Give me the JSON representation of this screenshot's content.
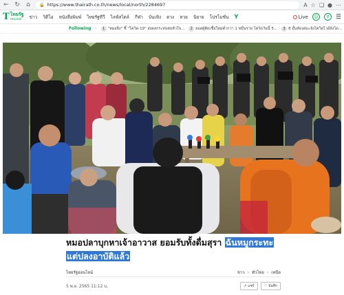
{
  "browser": {
    "url": "https://www.thairath.co.th/news/local/north/2284697",
    "back_icon": "back-arrow-icon",
    "refresh_icon": "refresh-icon",
    "home_icon": "home-icon"
  },
  "header": {
    "logo_main": "ไทยรัฐ",
    "logo_sub": "ONLINE",
    "menu": [
      "ข่าว",
      "วิดีโอ",
      "หนังสือพิมพ์",
      "ไทยรัฐทีวี",
      "ไลฟ์สไตล์",
      "กีฬา",
      "บันเทิง",
      "ดวง",
      "หวย",
      "นิยาย",
      "โปรโมชั่น"
    ],
    "live_label": "Live"
  },
  "ticker": {
    "following_label": "Following",
    "items": [
      {
        "num": "1",
        "text": "\"หมอยิ่ง\" ชี้ \"โควิด-19\" ส่งผลกระทบต่อหัวใจ..."
      },
      {
        "num": "2",
        "text": "ยอดผู้ติดเชื้อใหม่ต่ำกว่า 1 หมื่นราย โควิดวันนี้ 5..."
      },
      {
        "num": "3",
        "text": "8 อั้นห้องสมะจังโควิดไวอ์ลังโด..."
      }
    ]
  },
  "article": {
    "headline_plain": "หมอปลาบุกหาเจ้าอาวาส ยอมรับทั้งดื่มสุรา ",
    "headline_selected_1": "ฉันหมูกระทะ",
    "headline_selected_2": "แต่ปลงอาบัติแล้ว",
    "source": "ไทยรัฐออนไลน์",
    "breadcrumb": [
      "ข่าว",
      "ทั่วไทย",
      "เหนือ"
    ],
    "date": "5 พ.ย. 2565 11:12 น.",
    "share_label": "แชร์",
    "save_label": "บันทึก"
  },
  "colors": {
    "brand": "#00a651",
    "selection": "#2f78d6",
    "robe": "#e8731f"
  }
}
